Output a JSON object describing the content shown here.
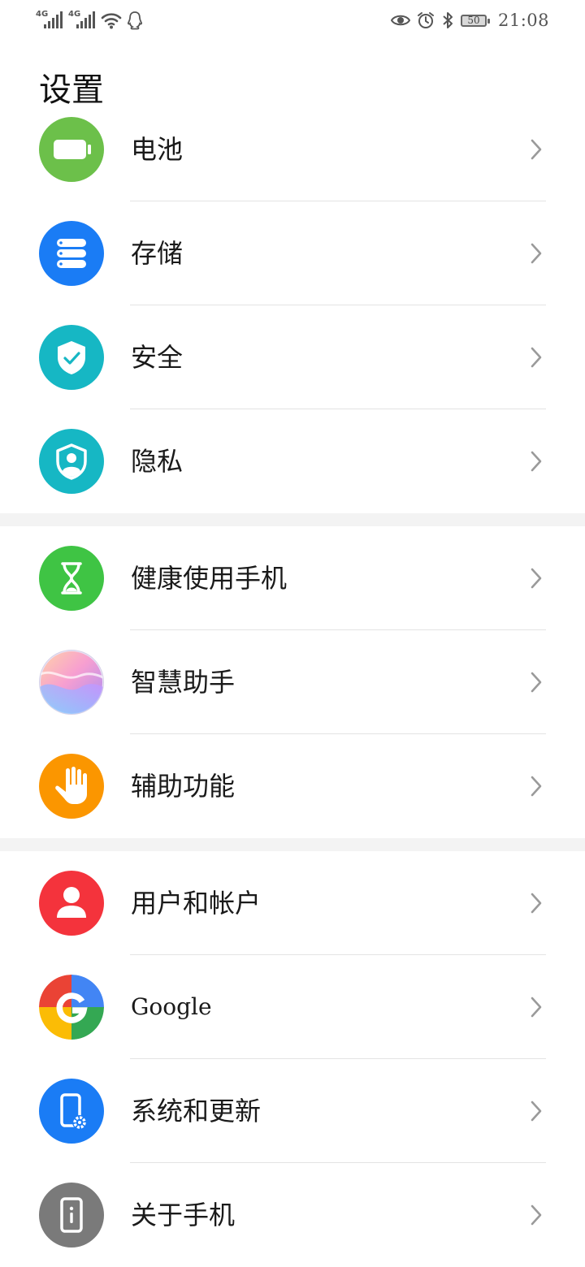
{
  "status_bar": {
    "sim1_label": "4G",
    "sim2_label": "4G",
    "time": "21:08",
    "battery_level": "50",
    "icons": [
      "signal-icon",
      "signal-icon",
      "wifi-icon",
      "qq-icon",
      "eye-icon",
      "alarm-icon",
      "bluetooth-icon",
      "battery-icon"
    ]
  },
  "header": {
    "title": "设置"
  },
  "sections": [
    {
      "items": [
        {
          "label": "电池",
          "icon": "battery-icon",
          "color": "#6cc04a"
        },
        {
          "label": "存储",
          "icon": "storage-icon",
          "color": "#1a7cf5"
        },
        {
          "label": "安全",
          "icon": "security-shield-icon",
          "color": "#16b7c4"
        },
        {
          "label": "隐私",
          "icon": "privacy-icon",
          "color": "#16b7c4"
        }
      ]
    },
    {
      "items": [
        {
          "label": "健康使用手机",
          "icon": "hourglass-icon",
          "color": "#3fc444"
        },
        {
          "label": "智慧助手",
          "icon": "assistant-icon",
          "color": "#c9a7f0"
        },
        {
          "label": "辅助功能",
          "icon": "hand-icon",
          "color": "#fb9600"
        }
      ]
    },
    {
      "items": [
        {
          "label": "用户和帐户",
          "icon": "user-icon",
          "color": "#f4333c"
        },
        {
          "label": "Google",
          "icon": "google-icon",
          "color": "#4285f4"
        },
        {
          "label": "系统和更新",
          "icon": "system-update-icon",
          "color": "#1a7cf5"
        },
        {
          "label": "关于手机",
          "icon": "about-phone-icon",
          "color": "#7a7a7a"
        }
      ]
    }
  ]
}
